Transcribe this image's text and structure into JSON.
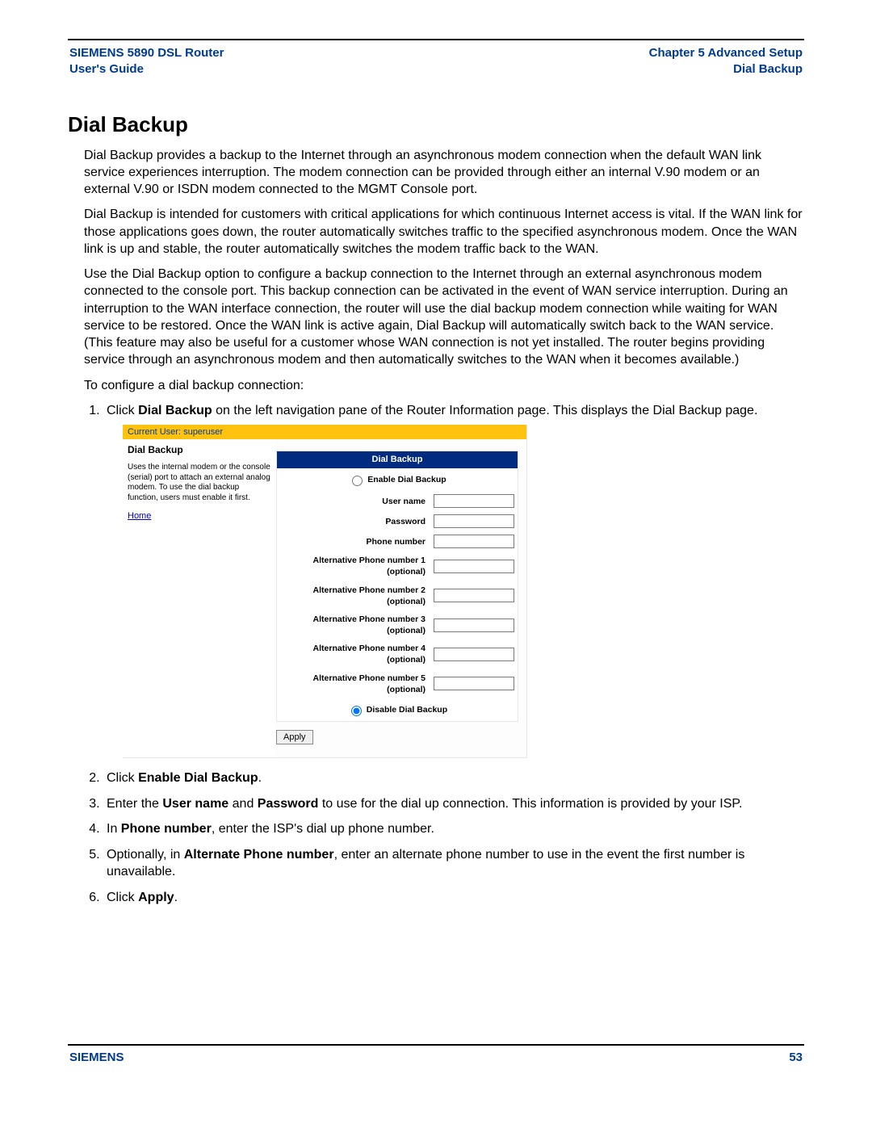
{
  "header": {
    "left_line1": "SIEMENS 5890 DSL Router",
    "left_line2": "User's Guide",
    "right_line1": "Chapter 5  Advanced Setup",
    "right_line2": "Dial Backup"
  },
  "title": "Dial Backup",
  "paragraphs": {
    "p1": "Dial Backup provides a backup to the Internet through an asynchronous modem connection when the default WAN link service experiences interruption. The modem connection can be provided through either an internal V.90 modem or an external V.90 or ISDN modem connected to the MGMT Console port.",
    "p2": "Dial Backup is intended for customers with critical applications for which continuous Internet access is vital. If the WAN link for those applications goes down, the router automatically switches traffic to the specified asynchronous modem. Once the WAN link is up and stable, the router automatically switches the modem traffic back to the WAN.",
    "p3": "Use the Dial Backup option to configure a backup connection to the Internet through an external asynchronous modem connected to the console port. This backup connection can be activated in the event of WAN service interruption. During an interruption to the WAN interface connection, the router will use the dial backup modem connection while waiting for WAN service to be restored. Once the WAN link is active again, Dial Backup will automatically switch back to the WAN service. (This feature may also be useful for a customer whose WAN connection is not yet installed. The router begins providing service through an asynchronous modem and then automatically switches to the WAN when it becomes available.)",
    "p4": "To configure a dial backup connection:"
  },
  "steps": {
    "s1_pre": "Click ",
    "s1_bold": "Dial Backup",
    "s1_post": " on the left navigation pane of the Router Information page. This displays the Dial Backup page.",
    "s2_pre": "Click ",
    "s2_bold": "Enable Dial Backup",
    "s2_post": ".",
    "s3_pre": "Enter the ",
    "s3_bold1": "User name",
    "s3_mid": " and ",
    "s3_bold2": "Password",
    "s3_post": " to use for the dial up connection. This information is provided by your ISP.",
    "s4_pre": "In ",
    "s4_bold": "Phone number",
    "s4_post": ", enter the ISP's dial up phone number.",
    "s5_pre": "Optionally, in ",
    "s5_bold": "Alternate Phone number",
    "s5_post": ", enter an alternate phone number to use in the event the first number is unavailable.",
    "s6_pre": "Click ",
    "s6_bold": "Apply",
    "s6_post": "."
  },
  "app": {
    "current_user": "Current User: superuser",
    "side_title": "Dial Backup",
    "side_desc": "Uses the internal modem or the console (serial) port to attach an external analog modem.  To use the dial backup function, users must enable it first.",
    "home_link": "Home",
    "form_header": "Dial Backup",
    "enable_label": "Enable Dial Backup",
    "username_label": "User name",
    "password_label": "Password",
    "phone_label": "Phone number",
    "alt1_label": "Alternative Phone number 1 (optional)",
    "alt2_label": "Alternative Phone number 2 (optional)",
    "alt3_label": "Alternative Phone number 3 (optional)",
    "alt4_label": "Alternative Phone number 4 (optional)",
    "alt5_label": "Alternative Phone number 5 (optional)",
    "disable_label": "Disable Dial Backup",
    "apply_label": "Apply"
  },
  "footer": {
    "brand": "SIEMENS",
    "page": "53"
  }
}
